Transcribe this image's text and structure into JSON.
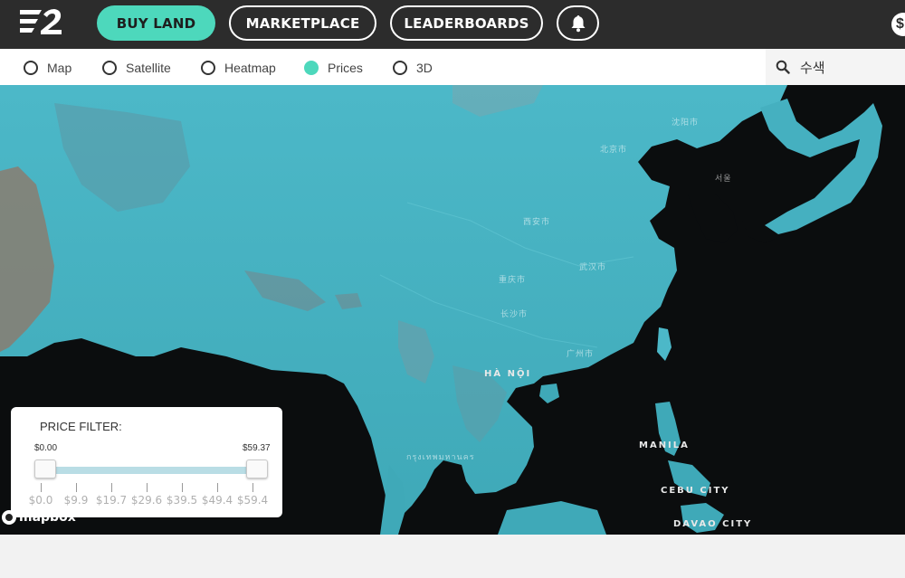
{
  "header": {
    "buy_land": "BUY LAND",
    "marketplace": "MARKETPLACE",
    "leaderboards": "LEADERBOARDS",
    "balance_symbol": "$"
  },
  "layers": {
    "options": [
      {
        "label": "Map",
        "selected": false
      },
      {
        "label": "Satellite",
        "selected": false
      },
      {
        "label": "Heatmap",
        "selected": false
      },
      {
        "label": "Prices",
        "selected": true
      },
      {
        "label": "3D",
        "selected": false
      }
    ],
    "accent_color": "#4dd8bc"
  },
  "search": {
    "value": "수색"
  },
  "map": {
    "labels": {
      "beijing": "北京市",
      "shenyang": "沈阳市",
      "seoul": "서울",
      "xian": "西安市",
      "wuhan": "武汉市",
      "chongqing": "重庆市",
      "changsha": "长沙市",
      "guangzhou": "广州市",
      "hanoi": "HÀ NỘI",
      "bangkok": "กรุงเทพมหานคร",
      "manila": "MANILA",
      "cebu": "CEBU CITY",
      "davao": "DAVAO CITY"
    },
    "attribution": "mapbox",
    "tint_color": "#47b5c4"
  },
  "price_filter": {
    "title": "PRICE FILTER:",
    "min_label": "$0.00",
    "max_label": "$59.37",
    "range_low": 0.0,
    "range_high": 59.37,
    "ticks": [
      "$0.0",
      "$9.9",
      "$19.7",
      "$29.6",
      "$39.5",
      "$49.4",
      "$59.4"
    ]
  }
}
